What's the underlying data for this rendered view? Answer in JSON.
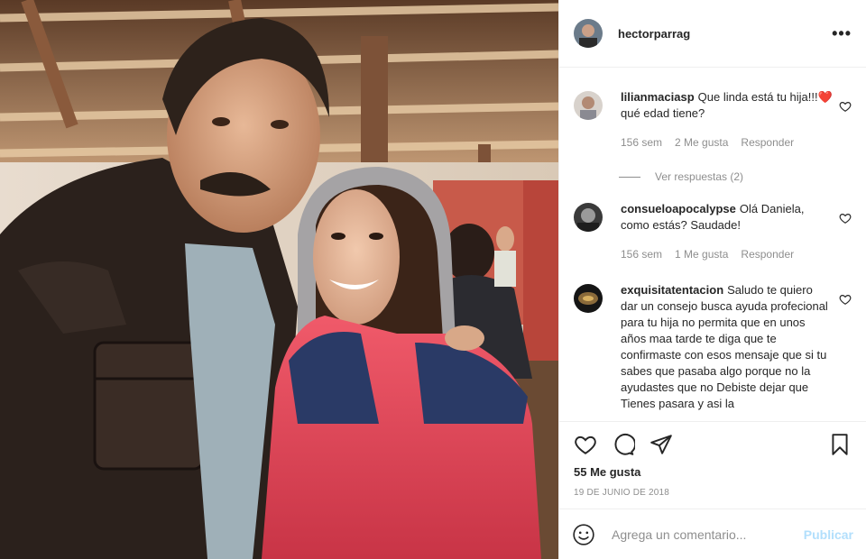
{
  "post": {
    "username": "hectorparrag",
    "more_label": "•••"
  },
  "comments": [
    {
      "user": "lilianmaciasp",
      "text": "Que linda está tu hija!!!❤️ qué edad tiene?",
      "time": "156 sem",
      "likes": "2 Me gusta",
      "reply": "Responder",
      "view_replies": "Ver respuestas (2)"
    },
    {
      "user": "consueloapocalypse",
      "text": "Olá Daniela, como estás? Saudade!",
      "time": "156 sem",
      "likes": "1 Me gusta",
      "reply": "Responder"
    },
    {
      "user": "exquisitatentacion",
      "text": "Saludo te quiero dar un consejo busca ayuda profecional para tu hija no permita que en unos años maa tarde te diga que te confirmaste con esos mensaje que si tu sabes que pasaba algo porque no la ayudastes que no Debiste dejar que Tienes pasara y asi la",
      "time": "",
      "likes": "",
      "reply": ""
    }
  ],
  "likes_label": "55 Me gusta",
  "date_label": "19 DE JUNIO DE 2018",
  "comment_input": {
    "placeholder": "Agrega un comentario...",
    "publish_label": "Publicar"
  },
  "colors": {
    "text": "#262626",
    "muted": "#8e8e8e",
    "publish": "#b2dffc",
    "heart": "#ed4956"
  }
}
